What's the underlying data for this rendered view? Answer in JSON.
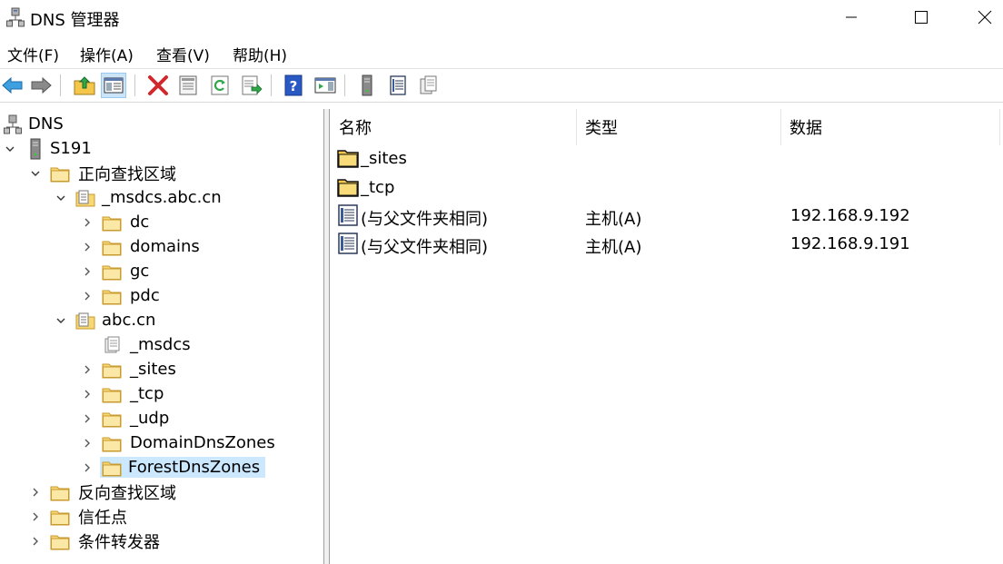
{
  "window": {
    "title": "DNS 管理器",
    "icon": "dns-server-icon",
    "controls": {
      "minimize": "minimize-icon",
      "maximize": "maximize-icon",
      "close": "close-icon"
    }
  },
  "menu": {
    "items": [
      "文件(F)",
      "操作(A)",
      "查看(V)",
      "帮助(H)"
    ]
  },
  "toolbar": {
    "buttons": [
      "back-arrow-icon",
      "forward-arrow-icon",
      "up-folder-icon",
      "show-hide-tree-icon",
      "delete-icon",
      "properties-icon",
      "refresh-icon",
      "export-list-icon",
      "help-icon",
      "action-pane-icon",
      "server-icon",
      "zone-records-icon",
      "copy-icon"
    ],
    "active": "show-hide-tree-icon",
    "colors": {
      "delete": "#d0282c",
      "help": "#2b59c3",
      "back": "#1a78c2",
      "folder": "#e8c35a"
    }
  },
  "tree": {
    "root": "DNS",
    "server": "S191",
    "forward_zones": "正向查找区域",
    "msdcs_zone": "_msdcs.abc.cn",
    "msdcs_children": [
      "dc",
      "domains",
      "gc",
      "pdc"
    ],
    "abc_zone": "abc.cn",
    "abc_children": [
      "_msdcs",
      "_sites",
      "_tcp",
      "_udp",
      "DomainDnsZones",
      "ForestDnsZones"
    ],
    "selected": "ForestDnsZones",
    "reverse_zones": "反向查找区域",
    "trust_points": "信任点",
    "conditional_forwarders": "条件转发器",
    "selection_color": "#cce8ff"
  },
  "list": {
    "columns": [
      "名称",
      "类型",
      "数据"
    ],
    "rows": [
      {
        "icon": "folder-icon",
        "name": "_sites",
        "type": "",
        "data": ""
      },
      {
        "icon": "folder-icon",
        "name": "_tcp",
        "type": "",
        "data": ""
      },
      {
        "icon": "record-icon",
        "name": "(与父文件夹相同)",
        "type": "主机(A)",
        "data": "192.168.9.192"
      },
      {
        "icon": "record-icon",
        "name": "(与父文件夹相同)",
        "type": "主机(A)",
        "data": "192.168.9.191"
      }
    ]
  }
}
